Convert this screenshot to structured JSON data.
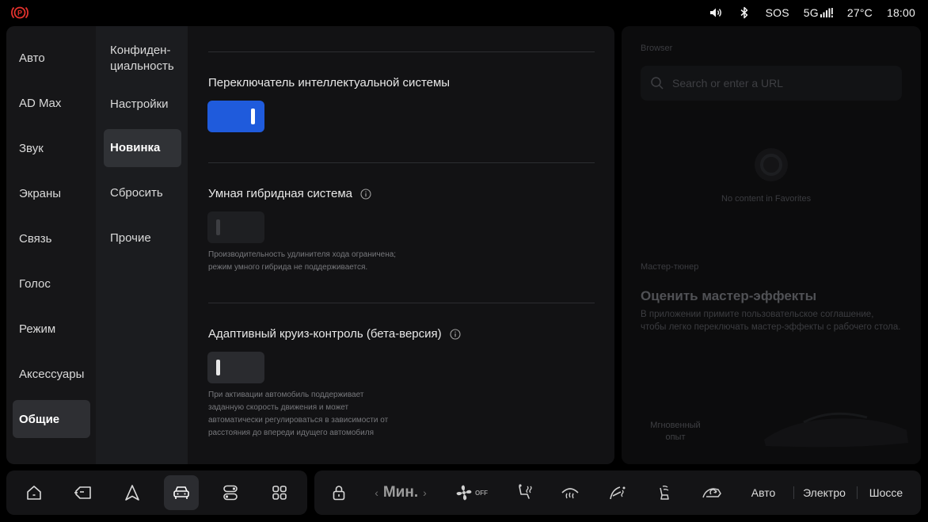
{
  "status_bar": {
    "icons": [
      "parking-brake-icon",
      "volume-icon",
      "bluetooth-icon",
      "signal-icon"
    ],
    "sos": "SOS",
    "network": "5G",
    "temperature": "27°C",
    "time": "18:00",
    "colors": {
      "brake": "#e5322d"
    }
  },
  "settings": {
    "nav_primary": [
      {
        "label": "Авто"
      },
      {
        "label": "AD Max"
      },
      {
        "label": "Звук"
      },
      {
        "label": "Экраны"
      },
      {
        "label": "Связь"
      },
      {
        "label": "Голос"
      },
      {
        "label": "Режим"
      },
      {
        "label": "Аксессуары"
      },
      {
        "label": "Общие",
        "active": true
      }
    ],
    "nav_secondary": [
      {
        "label": "Конфиден-\nциальность"
      },
      {
        "label": "Настройки"
      },
      {
        "label": "Новинка",
        "active": true
      },
      {
        "label": "Сбросить"
      },
      {
        "label": "Прочие"
      }
    ],
    "items": [
      {
        "title": "Переключатель интеллектуальной системы",
        "state": "on"
      },
      {
        "title": "Умная гибридная система",
        "info_icon": "info-icon",
        "state": "disabled",
        "description_lines": [
          "Производительность удлинителя хода ограничена;",
          "режим умного гибрида не поддерживается."
        ]
      },
      {
        "title": "Адаптивный круиз-контроль (бета-версия)",
        "info_icon": "info-icon",
        "state": "off",
        "description_lines": [
          "При активации автомобиль поддерживает",
          "заданную скорость движения и может",
          "автоматически регулироваться в зависимости от",
          "расстояния до впереди идущего автомобиля"
        ]
      }
    ],
    "colors": {
      "toggle_on": "#1f5bdc",
      "panel": "#161618"
    }
  },
  "browser": {
    "title": "Browser",
    "search_placeholder": "Search or enter a URL",
    "empty_text": "No content in Favorites",
    "tuner_label": "Мастер-тюнер",
    "tuner_heading": "Оценить мастер-эффекты",
    "tuner_desc_lines": [
      "В приложении примите пользовательское соглашение,",
      "чтобы легко переключать мастер-эффекты с рабочего стола."
    ],
    "instant_lines": [
      "Мгновенный",
      "опыт"
    ]
  },
  "dock": {
    "apps": [
      {
        "icon": "home-icon"
      },
      {
        "icon": "car-door-icon"
      },
      {
        "icon": "navigation-icon"
      },
      {
        "icon": "car-settings-icon",
        "active": true
      },
      {
        "icon": "toggles-icon"
      },
      {
        "icon": "apps-grid-icon"
      }
    ],
    "climate": {
      "lock_icon": "lock-icon",
      "fan_level": "Мин.",
      "fan_status": "OFF",
      "icons": [
        "fan-icon",
        "seat-heat-icon",
        "front-defrost-icon",
        "steering-heat-icon",
        "seat-vent-icon",
        "air-recirculation-icon"
      ]
    },
    "drive_modes": [
      "Авто",
      "Электро",
      "Шоссе"
    ]
  }
}
